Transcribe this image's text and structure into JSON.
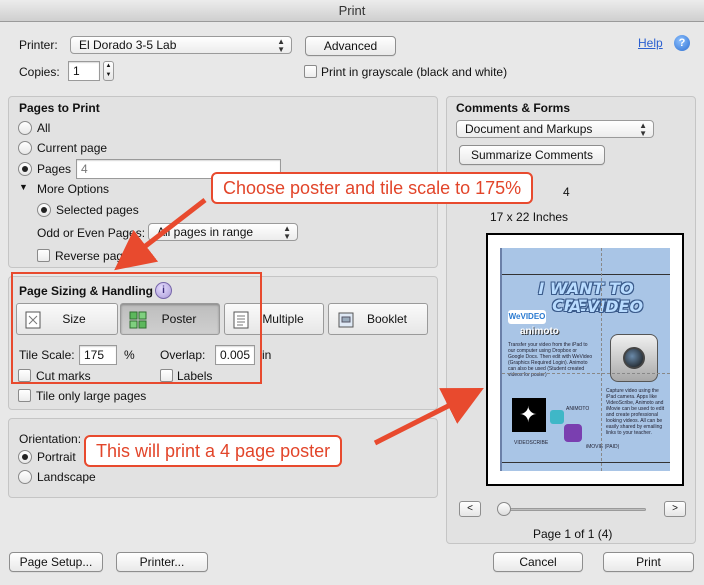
{
  "window": {
    "title": "Print"
  },
  "top": {
    "printer_label": "Printer:",
    "printer_value": "El Dorado 3-5 Lab",
    "advanced_label": "Advanced",
    "help_label": "Help",
    "help_icon_glyph": "?",
    "copies_label": "Copies:",
    "copies_value": "1",
    "grayscale_label": "Print in grayscale (black and white)"
  },
  "pages_to_print": {
    "heading": "Pages to Print",
    "all_label": "All",
    "current_label": "Current page",
    "pages_label": "Pages",
    "pages_value": "4",
    "more_options_label": "More Options",
    "selected_pages_label": "Selected pages",
    "odd_even_label": "Odd or Even Pages:",
    "odd_even_value": "All pages in range",
    "reverse_label": "Reverse pages"
  },
  "sizing": {
    "heading": "Page Sizing & Handling",
    "info_glyph": "i",
    "size_label": "Size",
    "poster_label": "Poster",
    "multiple_label": "Multiple",
    "booklet_label": "Booklet",
    "tile_scale_label": "Tile Scale:",
    "tile_scale_value": "175",
    "tile_scale_unit": "%",
    "overlap_label": "Overlap:",
    "overlap_value": "0.005",
    "overlap_unit": "in",
    "cut_marks_label": "Cut marks",
    "labels_label": "Labels",
    "tile_only_large_label": "Tile only large pages"
  },
  "orientation": {
    "heading": "Orientation:",
    "portrait_label": "Portrait",
    "landscape_label": "Landscape"
  },
  "comments": {
    "heading": "Comments & Forms",
    "value": "Document and Markups",
    "summarize_label": "Summarize Comments"
  },
  "preview": {
    "scale_partial": "4",
    "paper_size": "17 x 22 Inches",
    "page_counter": "Page 1 of 1 (4)",
    "prev_glyph": "<",
    "next_glyph": ">"
  },
  "poster": {
    "title_line1": "I WANT TO CREATE",
    "title_line2": "A VIDEO",
    "wevideo": "WeVIDEO",
    "animoto": "animoto",
    "left_text": "Transfer your video from the iPad to our computer using Dropbox or Google Docs. Then edit with WeVideo (Graphics Required Login). Animoto can also be used (Student created videos for poster)",
    "right_text": "Capture video using the iPad camera. Apps like VideoScribe, Animoto and iMovie can be used to edit and create professional looking videos. All can be easily shared by emailing links to your teacher.",
    "animoto_small": "ANIMOTO",
    "videoscribe_small": "VIDEOSCRIBE",
    "imovie_small": "iMOVIE (PAID)"
  },
  "callouts": {
    "tile_scale": "Choose poster and tile scale to 175%",
    "four_page": "This will print a 4 page poster"
  },
  "bottom": {
    "page_setup_label": "Page Setup...",
    "printer_btn_label": "Printer...",
    "cancel_label": "Cancel",
    "print_label": "Print"
  },
  "colors": {
    "callout": "#e84a2e",
    "help_link": "#2b5fd0",
    "help_icon": "#3a7bd5",
    "poster_bg": "#a9c5e6"
  }
}
